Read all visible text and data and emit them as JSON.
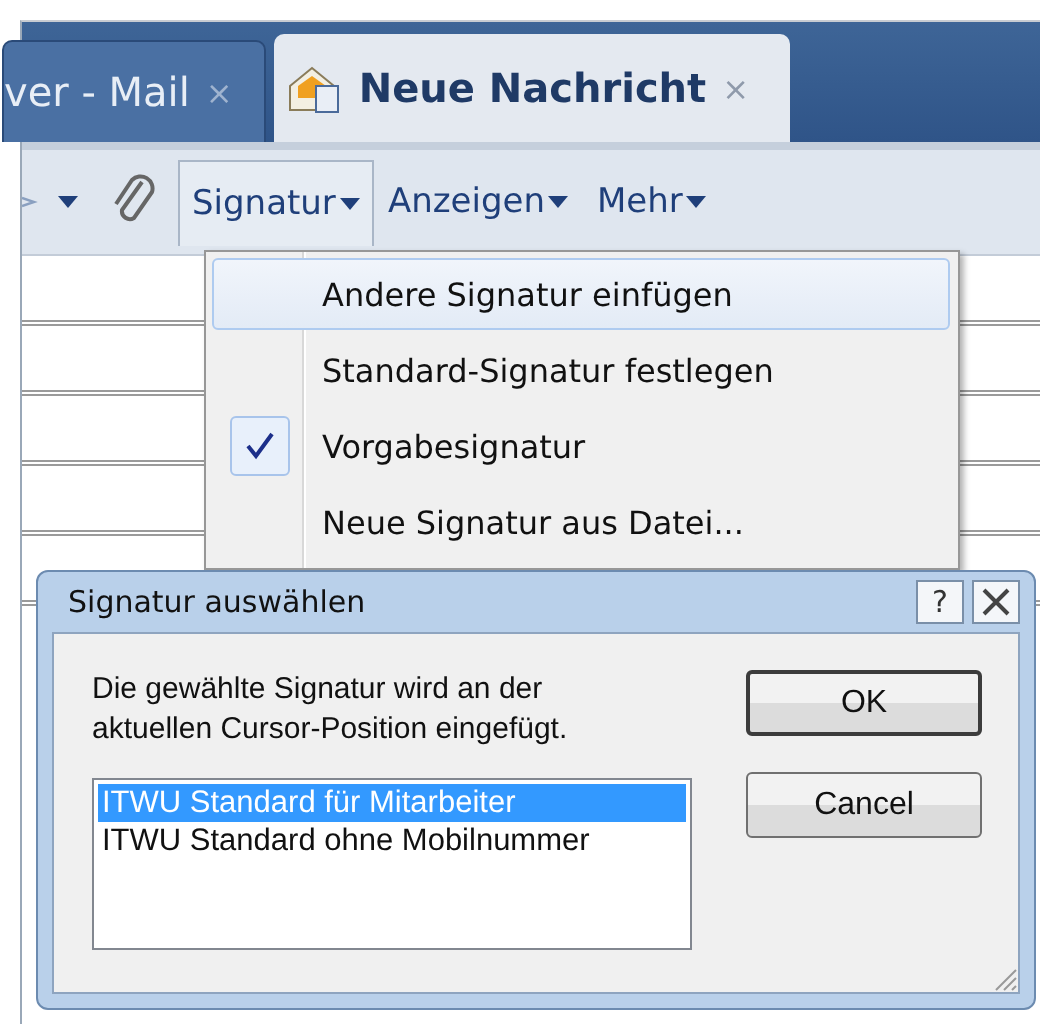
{
  "tabs": [
    {
      "label": "ver - Mail",
      "close": "×",
      "selected": false
    },
    {
      "label": "Neue Nachricht",
      "close": "×",
      "selected": true
    }
  ],
  "toolbar": {
    "menus": [
      {
        "label": "Signatur",
        "selected": true
      },
      {
        "label": "Anzeigen",
        "selected": false
      },
      {
        "label": "Mehr",
        "selected": false
      }
    ]
  },
  "signature_menu": {
    "items": [
      {
        "label": "Andere Signatur einfügen",
        "selected": true,
        "checked": false
      },
      {
        "label": "Standard-Signatur festlegen",
        "selected": false,
        "checked": false
      },
      {
        "label": "Vorgabesignatur",
        "selected": false,
        "checked": true
      },
      {
        "label": "Neue Signatur aus Datei...",
        "selected": false,
        "checked": false
      }
    ]
  },
  "dialog": {
    "title": "Signatur auswählen",
    "help": "?",
    "message": "Die gewählte Signatur wird an der aktuellen Cursor-Position eingefügt.",
    "signatures": [
      {
        "label": "ITWU Standard für Mitarbeiter",
        "selected": true
      },
      {
        "label": "ITWU Standard ohne Mobilnummer",
        "selected": false
      }
    ],
    "buttons": [
      {
        "label": "OK",
        "default": true
      },
      {
        "label": "Cancel",
        "default": false
      }
    ]
  }
}
